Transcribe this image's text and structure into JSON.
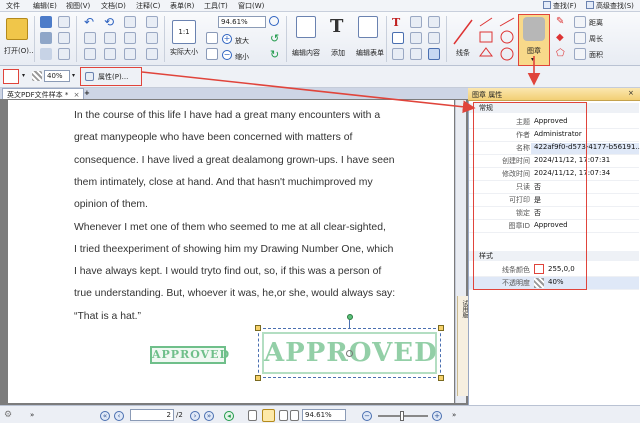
{
  "menu": [
    "文件",
    "编辑(E)",
    "视图(V)",
    "文档(D)",
    "注释(C)",
    "表单(R)",
    "工具(T)",
    "窗口(W)"
  ],
  "right_links": [
    "查找(F)",
    "高级查找(S)"
  ],
  "ribbon": {
    "open_label": "打开(O)...",
    "zoom_value": "94.61%",
    "actual_size_label": "实际大小",
    "zoom_in_label": "放大",
    "zoom_out_label": "缩小",
    "edit_content_label": "编辑内容",
    "add_label": "添加",
    "edit_form_label": "编辑表单",
    "line_label": "线条",
    "stamp_label": "图章",
    "distance_label": "距离",
    "perimeter_label": "周长",
    "area_label": "面积"
  },
  "property_bar": {
    "opacity_value": "40%",
    "properties_label": "属性(P)..."
  },
  "tab": {
    "label": "英文PDF文件样本 *",
    "add": "+"
  },
  "document": {
    "lines": [
      "In the course of this life I have had a great many encounters with a",
      "great manypeople who have been concerned with matters of",
      "consequence. I have lived a great dealamong grown-ups. I have seen",
      "them intimately, close at hand. And that hasn't muchimproved my",
      "opinion of them.",
      "Whenever I met one of them who seemed to me at all clear-sighted,",
      "I tried theexperiment of showing him my Drawing Number One, which",
      "I have always kept. I would tryto find out, so,     if this was a person of",
      "true understanding. But, whoever it was,     he,or she, would always say:",
      "“That is a hat.”"
    ],
    "stamp_small": "APPROVED",
    "stamp_large": "APPROVED"
  },
  "side_strip_label": "试用版",
  "panel": {
    "title": "图章 属性",
    "section_general": "常规",
    "section_style": "样式",
    "general": [
      {
        "key": "主题",
        "value": "Approved"
      },
      {
        "key": "作者",
        "value": "Administrator"
      },
      {
        "key": "名称",
        "value": "422af9f0-d573-4177-b56191..."
      },
      {
        "key": "创建时间",
        "value": "2024/11/12, 17:07:31"
      },
      {
        "key": "修改时间",
        "value": "2024/11/12, 17:07:34"
      },
      {
        "key": "只读",
        "value": "否"
      },
      {
        "key": "可打印",
        "value": "是"
      },
      {
        "key": "锁定",
        "value": "否"
      },
      {
        "key": "图章ID",
        "value": "Approved"
      }
    ],
    "style": [
      {
        "key": "线条颜色",
        "value": "255,0,0"
      },
      {
        "key": "不透明度",
        "value": "40%"
      }
    ]
  },
  "status": {
    "page_value": "2",
    "page_total": "/2",
    "zoom_value": "94.61%"
  },
  "colors": {
    "highlight_red": "#e0443b",
    "stamp_green": "#6fbf8a",
    "panel_header": "#f2cf75"
  }
}
